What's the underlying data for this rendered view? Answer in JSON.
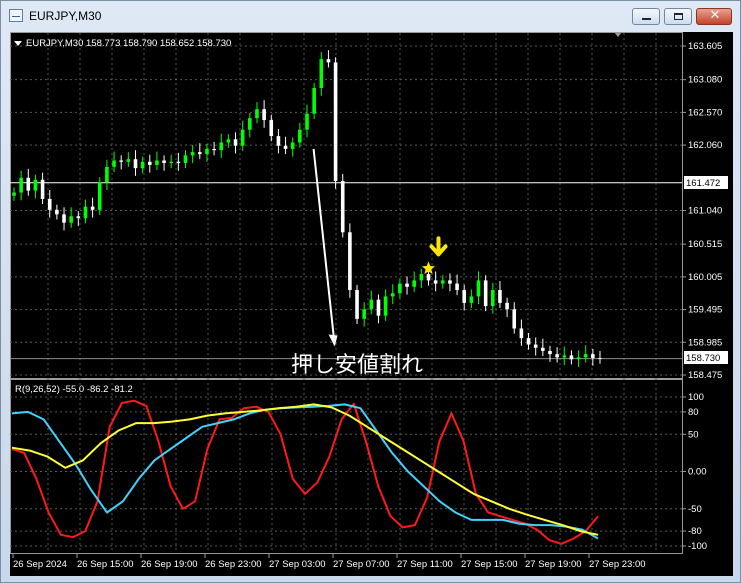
{
  "window": {
    "title": "EURJPY,M30"
  },
  "chart_header": "EURJPY,M30  158.773 158.790 158.652 158.730",
  "annotation": "押し安値割れ",
  "current_price_label": "158.730",
  "hline_label": "161.472",
  "indicator_label": "R(9,26,52) -55.0 -86.2 -81.2",
  "colors": {
    "bull": "#00ff00",
    "bear": "#ffffff",
    "grid": "#5a5a5a",
    "fast": "#ff1a1a",
    "mid": "#3fd4ff",
    "slow": "#ffff33",
    "marker": "#ffe600"
  },
  "icons": {
    "pin": "triangle-marker-icon",
    "star": "star-icon",
    "arrow": "down-arrow-icon"
  },
  "chart_data": [
    {
      "type": "candlestick",
      "symbol": "EURJPY",
      "timeframe": "M30",
      "ylim": [
        158.475,
        163.605
      ],
      "y_ticks": [
        "163.605",
        "163.080",
        "162.570",
        "162.060",
        "161.040",
        "160.515",
        "160.005",
        "159.495",
        "158.985",
        "158.475"
      ],
      "x_ticks": [
        "26 Sep 2024",
        "26 Sep 15:00",
        "26 Sep 19:00",
        "26 Sep 23:00",
        "27 Sep 03:00",
        "27 Sep 07:00",
        "27 Sep 11:00",
        "27 Sep 15:00",
        "27 Sep 19:00",
        "27 Sep 23:00"
      ],
      "horizontal_line": 161.472,
      "last_price": 158.73,
      "closes": [
        161.32,
        161.55,
        161.35,
        161.52,
        161.22,
        161.05,
        160.98,
        160.85,
        160.95,
        160.92,
        161.1,
        161.05,
        161.48,
        161.72,
        161.82,
        161.8,
        161.84,
        161.7,
        161.8,
        161.75,
        161.82,
        161.78,
        161.8,
        161.78,
        161.9,
        161.95,
        161.92,
        162.0,
        161.98,
        162.1,
        162.15,
        162.05,
        162.3,
        162.48,
        162.62,
        162.45,
        162.2,
        162.05,
        162.0,
        162.1,
        162.3,
        162.55,
        162.95,
        163.4,
        163.35,
        161.5,
        160.7,
        159.8,
        159.35,
        159.5,
        159.65,
        159.4,
        159.7,
        159.75,
        159.9,
        159.85,
        159.95,
        160.05,
        159.95,
        159.9,
        159.95,
        159.9,
        159.8,
        159.6,
        159.7,
        159.95,
        159.55,
        159.8,
        159.6,
        159.5,
        159.2,
        159.05,
        158.95,
        158.9,
        158.85,
        158.8,
        158.75,
        158.78,
        158.72,
        158.75,
        158.8,
        158.74,
        158.73
      ],
      "marker_index": 58,
      "arrow_from_price": 162.0,
      "arrow_to_price": 158.95
    },
    {
      "type": "line",
      "title": "R(9,26,52)",
      "ylim": [
        -110,
        110
      ],
      "y_ticks": [
        "100",
        "80",
        "50",
        "0.00",
        "-50",
        "-80",
        "-100"
      ],
      "series": [
        {
          "name": "9",
          "values": [
            30,
            25,
            -10,
            -55,
            -85,
            -88,
            -80,
            -40,
            60,
            92,
            95,
            88,
            40,
            -20,
            -50,
            -40,
            30,
            70,
            72,
            85,
            87,
            80,
            50,
            -10,
            -30,
            -15,
            20,
            70,
            91,
            40,
            -20,
            -60,
            -75,
            -72,
            -35,
            40,
            78,
            40,
            -30,
            -55,
            -60,
            -65,
            -70,
            -78,
            -92,
            -97,
            -90,
            -80,
            -60
          ]
        },
        {
          "name": "26",
          "values": [
            78,
            80,
            70,
            40,
            10,
            -25,
            -55,
            -40,
            -10,
            15,
            30,
            45,
            60,
            65,
            70,
            78,
            83,
            85,
            86,
            87,
            88,
            90,
            85,
            55,
            25,
            0,
            -20,
            -40,
            -55,
            -65,
            -65,
            -65,
            -70,
            -72,
            -72,
            -74,
            -78,
            -90
          ]
        },
        {
          "name": "52",
          "values": [
            32,
            28,
            20,
            5,
            15,
            38,
            55,
            65,
            65,
            67,
            70,
            75,
            78,
            80,
            82,
            85,
            87,
            90,
            86,
            75,
            60,
            45,
            30,
            15,
            0,
            -15,
            -30,
            -40,
            -50,
            -58,
            -65,
            -72,
            -80,
            -85
          ]
        }
      ]
    }
  ]
}
